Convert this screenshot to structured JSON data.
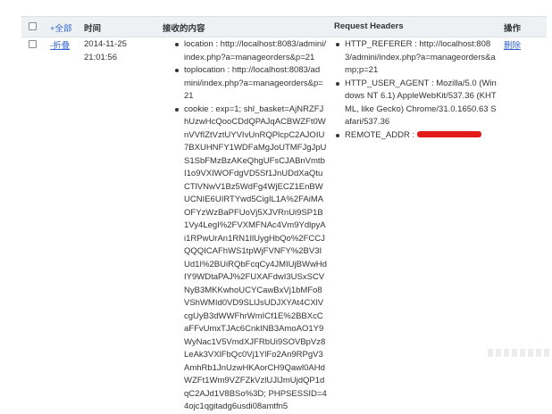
{
  "header": {
    "select_all_label": "+全部",
    "time": "时间",
    "content": "接收的内容",
    "request_headers": "Request Headers",
    "actions": "操作"
  },
  "row": {
    "collapse_label": "-折叠",
    "date": "2014-11-25",
    "clock": "21:01:56",
    "delete_label": "删除",
    "content_items": [
      "location : http://localhost:8083/admini/index.php?a=manageorders&p=21",
      "toplocation : http://localhost:8083/admini/index.php?a=manageorders&p=21",
      "cookie : exp=1; shl_basket=AjNRZFJhUzwHcQooCDdQPAJqACBWZFt0WnVVfIZtVztUYVIvUnRQPlcpC2AJOIU7BXUHNFY1WDFaMgJoUTMFJgJpUS1SbFMzBzAKeQhgUFsCJABnVmtbI1o9VXIWOFdgVD5Sf1JnUDdXaQtuCTlVNwV1Bz5WdFg4WjECZ1EnBWUCNIE6UIRTYwd5CigIL1A%2FAiMAOFYzWzBaPFUoVj5XJVRnUi9SP1B1Vy4LegI%2FVXMFNAc4Vm9YdlpyAi1RPwUrAn1RN1IlUygHbQo%2FCCJQQQICAFhWS1tpWjFVNFY%2BV3IUd1I%2BUiRQbFcqCy4JMIUjBWwHdIY9WDtaPAJ%2FUXAFdwI3USxSCVNyB3MKKwhoUCYCawBxVj1bMFo8VShWMId0VD9SLlJsUDJXYAt4CXlVcgUyB3dWWFhrWmICf1E%2BBXcCaFFvUmxTJAc6CnkINB3AmoAO1Y9WyNac1V5VmdXJFRbUi9SOVBpVz8LeAk3VXlFbQc0Vj1YlFo2An9RPgV3AmhRb1JnUzwHKAorCH9Qawl0AHdWZFt1Wm9VZFZkVzlUJlJmUjdQP1dqC2AJd1V8BSo%3D; PHPSESSID=44ojc1qgitadg6usdi08amtfn5"
    ],
    "header_items": [
      "HTTP_REFERER : http://localhost:8083/admini/index.php?a=manageorders&amp;p=21",
      "HTTP_USER_AGENT : Mozilla/5.0 (Windows NT 6.1) AppleWebKit/537.36 (KHTML, like Gecko) Chrome/31.0.1650.63 Safari/537.36",
      "REMOTE_ADDR :"
    ]
  }
}
